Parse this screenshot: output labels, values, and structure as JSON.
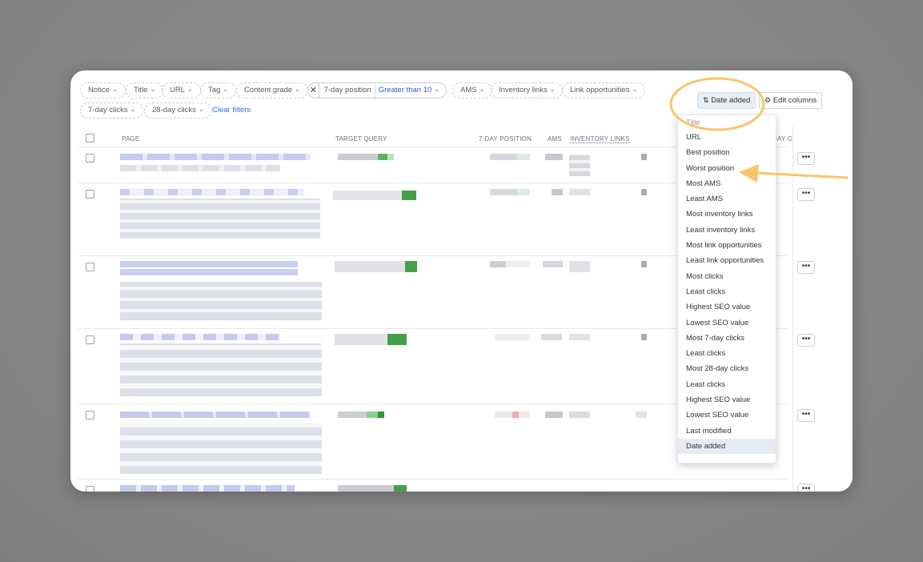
{
  "filters": {
    "chips": [
      {
        "label": "Notice"
      },
      {
        "label": "Title"
      },
      {
        "label": "URL"
      },
      {
        "label": "Tag"
      },
      {
        "label": "Content grade"
      }
    ],
    "active": {
      "label": "7-day position",
      "value": "Greater than 10"
    },
    "chips2": [
      {
        "label": "AMS"
      },
      {
        "label": "Inventory links"
      },
      {
        "label": "Link opportunities"
      }
    ],
    "row2": [
      {
        "label": "7-day clicks"
      },
      {
        "label": "28-day clicks"
      }
    ],
    "clear": "Clear filters"
  },
  "toolbar": {
    "sort_label": "Date added",
    "edit_columns": "Edit columns"
  },
  "table": {
    "headers": {
      "page": "PAGE",
      "target_query": "TARGET QUERY",
      "position": "7-DAY POSITION",
      "ams": "AMS",
      "inventory_links": "INVENTORY LINKS",
      "clicks_partial": "DAY C"
    },
    "more_label": "•••"
  },
  "sort_menu": {
    "items": [
      "Title",
      "URL",
      "Best position",
      "Worst position",
      "Most AMS",
      "Least AMS",
      "Most inventory links",
      "Least inventory links",
      "Most link opportunities",
      "Least link opportunities",
      "Most clicks",
      "Least clicks",
      "Highest SEO value",
      "Lowest SEO value",
      "Most 7-day clicks",
      "Least clicks",
      "Most 28-day clicks",
      "Least clicks",
      "Highest SEO value",
      "Lowest SEO value",
      "Last modified",
      "Date added"
    ],
    "selected": "Date added"
  },
  "colors": {
    "accent_link": "#2f6fd6",
    "highlight_annotation": "#f7c66a",
    "blurred_link": "#c9cdf0",
    "green": "#3aa845"
  },
  "icons": {
    "sort": "sort-arrows-icon",
    "edit": "gear-icon",
    "remove": "close-icon",
    "dropdown": "chevron-down-icon"
  }
}
